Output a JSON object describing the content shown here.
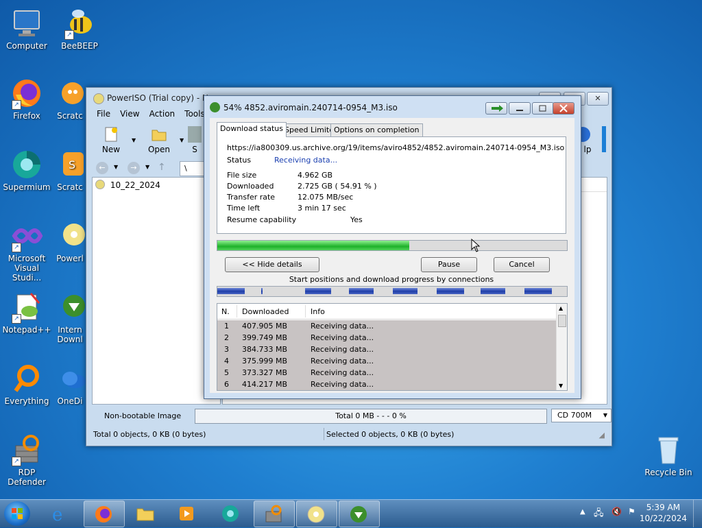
{
  "desktop": {
    "icons": [
      {
        "label": "Computer",
        "icon": "computer-icon"
      },
      {
        "label": "BeeBEEP",
        "icon": "bee-icon"
      },
      {
        "label": "Firefox",
        "icon": "firefox-icon"
      },
      {
        "label": "Scratc",
        "icon": "scratch-icon"
      },
      {
        "label": "Supermium",
        "icon": "supermium-icon"
      },
      {
        "label": "Scratc",
        "icon": "scratch-icon"
      },
      {
        "label": "Microsoft Visual Studi...",
        "icon": "visual-studio-icon"
      },
      {
        "label": "Powerl",
        "icon": "poweriso-icon"
      },
      {
        "label": "Notepad++",
        "icon": "notepadpp-icon"
      },
      {
        "label": "Intern Downl",
        "icon": "idm-icon"
      },
      {
        "label": "Everything",
        "icon": "everything-icon"
      },
      {
        "label": "OneDi",
        "icon": "onedrive-icon"
      },
      {
        "label": "RDP Defender",
        "icon": "rdp-defender-icon"
      },
      {
        "label": "Recycle Bin",
        "icon": "recycle-bin-icon"
      }
    ]
  },
  "poweriso": {
    "title": "PowerISO (Trial copy) - Ne",
    "menu": [
      "File",
      "View",
      "Action",
      "Tools"
    ],
    "toolbar": {
      "new": "New",
      "open": "Open",
      "save_partial": "S",
      "help_partial": "lp"
    },
    "address": "\\",
    "tree_item": "10_22_2024",
    "image_type": "Non-bootable Image",
    "total": "Total  0 MB   - - -  0 %",
    "media": "CD 700M",
    "status_left": "Total 0 objects, 0 KB (0 bytes)",
    "status_right": "Selected 0 objects, 0 KB (0 bytes)"
  },
  "idm": {
    "title": "54% 4852.aviromain.240714-0954_M3.iso",
    "tabs": [
      "Download status",
      "Speed Limiter",
      "Options on completion"
    ],
    "url": "https://ia800309.us.archive.org/19/items/aviro4852/4852.aviromain.240714-0954_M3.iso",
    "status_label": "Status",
    "status_value": "Receiving data...",
    "file_size_label": "File size",
    "file_size_value": "4.962  GB",
    "downloaded_label": "Downloaded",
    "downloaded_value": "2.725  GB  ( 54.91 % )",
    "transfer_rate_label": "Transfer rate",
    "transfer_rate_value": "12.075  MB/sec",
    "time_left_label": "Time left",
    "time_left_value": "3 min 17 sec",
    "resume_label": "Resume capability",
    "resume_value": "Yes",
    "progress_fraction": 0.5491,
    "hide_details": "<< Hide details",
    "pause": "Pause",
    "cancel": "Cancel",
    "connections_label": "Start positions and download progress by connections",
    "columns": [
      "N.",
      "Downloaded",
      "Info"
    ],
    "connections": [
      {
        "n": "1",
        "downloaded": "407.905  MB",
        "info": "Receiving data..."
      },
      {
        "n": "2",
        "downloaded": "399.749  MB",
        "info": "Receiving data..."
      },
      {
        "n": "3",
        "downloaded": "384.733  MB",
        "info": "Receiving data..."
      },
      {
        "n": "4",
        "downloaded": "375.999  MB",
        "info": "Receiving data..."
      },
      {
        "n": "5",
        "downloaded": "373.327  MB",
        "info": "Receiving data..."
      },
      {
        "n": "6",
        "downloaded": "414.217  MB",
        "info": "Receiving data..."
      }
    ]
  },
  "taskbar": {
    "time": "5:39 AM",
    "date": "10/22/2024",
    "apps": [
      "ie-icon",
      "firefox-icon",
      "explorer-icon",
      "media-player-icon",
      "supermium-icon",
      "rdp-defender-icon",
      "poweriso-icon",
      "idm-icon"
    ]
  },
  "colors": {
    "accent": "#1eb12a",
    "connection_segment": "#1e3ea8",
    "status_text": "#1a3fb0"
  }
}
